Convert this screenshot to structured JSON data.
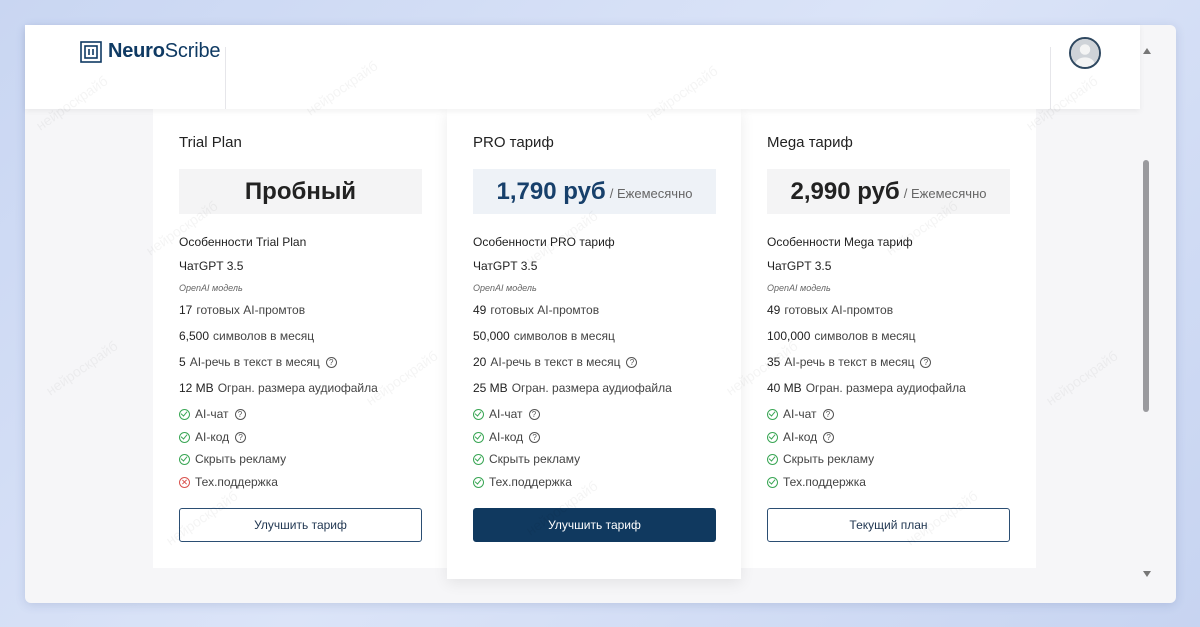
{
  "brand": {
    "name_bold": "Neuro",
    "name_light": "Scribe"
  },
  "plans": [
    {
      "title": "Trial Plan",
      "price": "Пробный",
      "period": "",
      "features_heading": "Особенности Trial Plan",
      "model": "ЧатGPT 3.5",
      "model_note": "OpenAI модель",
      "prompts_num": "17",
      "prompts_label": "готовых AI-промтов",
      "chars_num": "6,500",
      "chars_label": "символов в месяц",
      "speech_num": "5",
      "speech_label": "AI-речь в текст в месяц",
      "audio_num": "12 MB",
      "audio_label": "Огран. размера аудиофайла",
      "chat": "AI-чат",
      "code": "AI-код",
      "ads": "Скрыть рекламу",
      "support": "Тех.поддержка",
      "support_available": false,
      "button": "Улучшить тариф"
    },
    {
      "title": "PRO тариф",
      "price": "1,790 руб",
      "period": "/ Ежемесячно",
      "features_heading": "Особенности PRO тариф",
      "model": "ЧатGPT 3.5",
      "model_note": "OpenAI модель",
      "prompts_num": "49",
      "prompts_label": "готовых AI-промтов",
      "chars_num": "50,000",
      "chars_label": "символов в месяц",
      "speech_num": "20",
      "speech_label": "AI-речь в текст в месяц",
      "audio_num": "25 MB",
      "audio_label": "Огран. размера аудиофайла",
      "chat": "AI-чат",
      "code": "AI-код",
      "ads": "Скрыть рекламу",
      "support": "Тех.поддержка",
      "support_available": true,
      "button": "Улучшить тариф"
    },
    {
      "title": "Mega тариф",
      "price": "2,990 руб",
      "period": "/ Ежемесячно",
      "features_heading": "Особенности Mega тариф",
      "model": "ЧатGPT 3.5",
      "model_note": "OpenAI модель",
      "prompts_num": "49",
      "prompts_label": "готовых AI-промтов",
      "chars_num": "100,000",
      "chars_label": "символов в месяц",
      "speech_num": "35",
      "speech_label": "AI-речь в текст в месяц",
      "audio_num": "40 MB",
      "audio_label": "Огран. размера аудиофайла",
      "chat": "AI-чат",
      "code": "AI-код",
      "ads": "Скрыть рекламу",
      "support": "Тех.поддержка",
      "support_available": true,
      "button": "Текущий план"
    }
  ],
  "watermark": "нейроскрайб",
  "colors": {
    "brand": "#0f3a63",
    "primary_button": "#10395f",
    "check": "#3aa655",
    "cross": "#d9534f"
  }
}
